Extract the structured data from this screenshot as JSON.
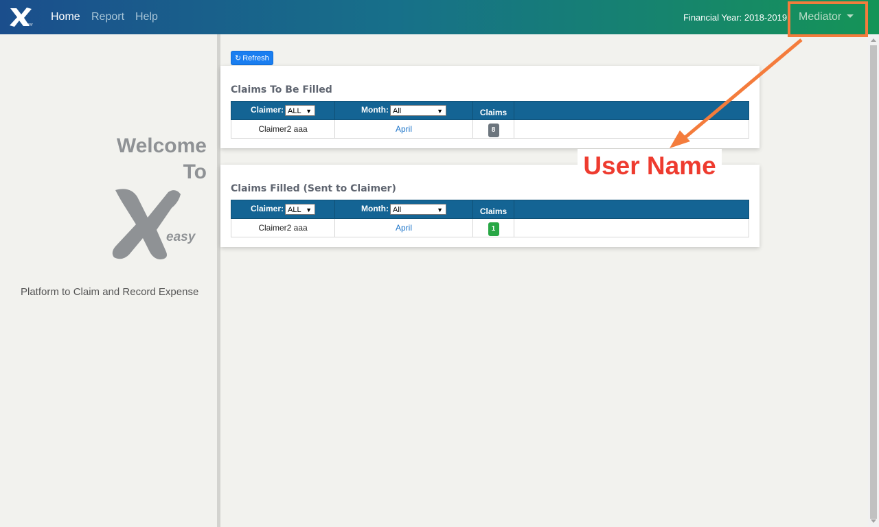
{
  "navbar": {
    "logo_icon": "xeasy-logo-icon",
    "links": [
      "Home",
      "Report",
      "Help"
    ],
    "active": "Home",
    "financial_year": "Financial Year: 2018-2019",
    "user_label": "Mediator"
  },
  "sidebar": {
    "welcome_line1": "Welcome",
    "welcome_line2": "To",
    "logo_text": "easy",
    "tagline": "Platform to Claim and Record Expense"
  },
  "toolbar": {
    "refresh_label": "Refresh",
    "refresh_icon": "refresh-icon"
  },
  "claims_to_be_filled": {
    "title": "Claims To Be Filled",
    "headers": {
      "claimer": "Claimer:",
      "month": "Month:",
      "claims": "Claims"
    },
    "claimer_filter": "ALL",
    "month_filter": "All",
    "rows": [
      {
        "claimer": "Claimer2 aaa",
        "month": "April",
        "claims": "8"
      }
    ],
    "badge_color": "#6c757d"
  },
  "claims_filled": {
    "title": "Claims Filled (Sent to Claimer)",
    "headers": {
      "claimer": "Claimer:",
      "month": "Month:",
      "claims": "Claims"
    },
    "claimer_filter": "ALL",
    "month_filter": "All",
    "rows": [
      {
        "claimer": "Claimer2 aaa",
        "month": "April",
        "claims": "1"
      }
    ],
    "badge_color": "#28a745"
  },
  "annotation": {
    "label": "User Name",
    "color": "#ee3b2f",
    "arrow_color": "#f47c3c"
  }
}
